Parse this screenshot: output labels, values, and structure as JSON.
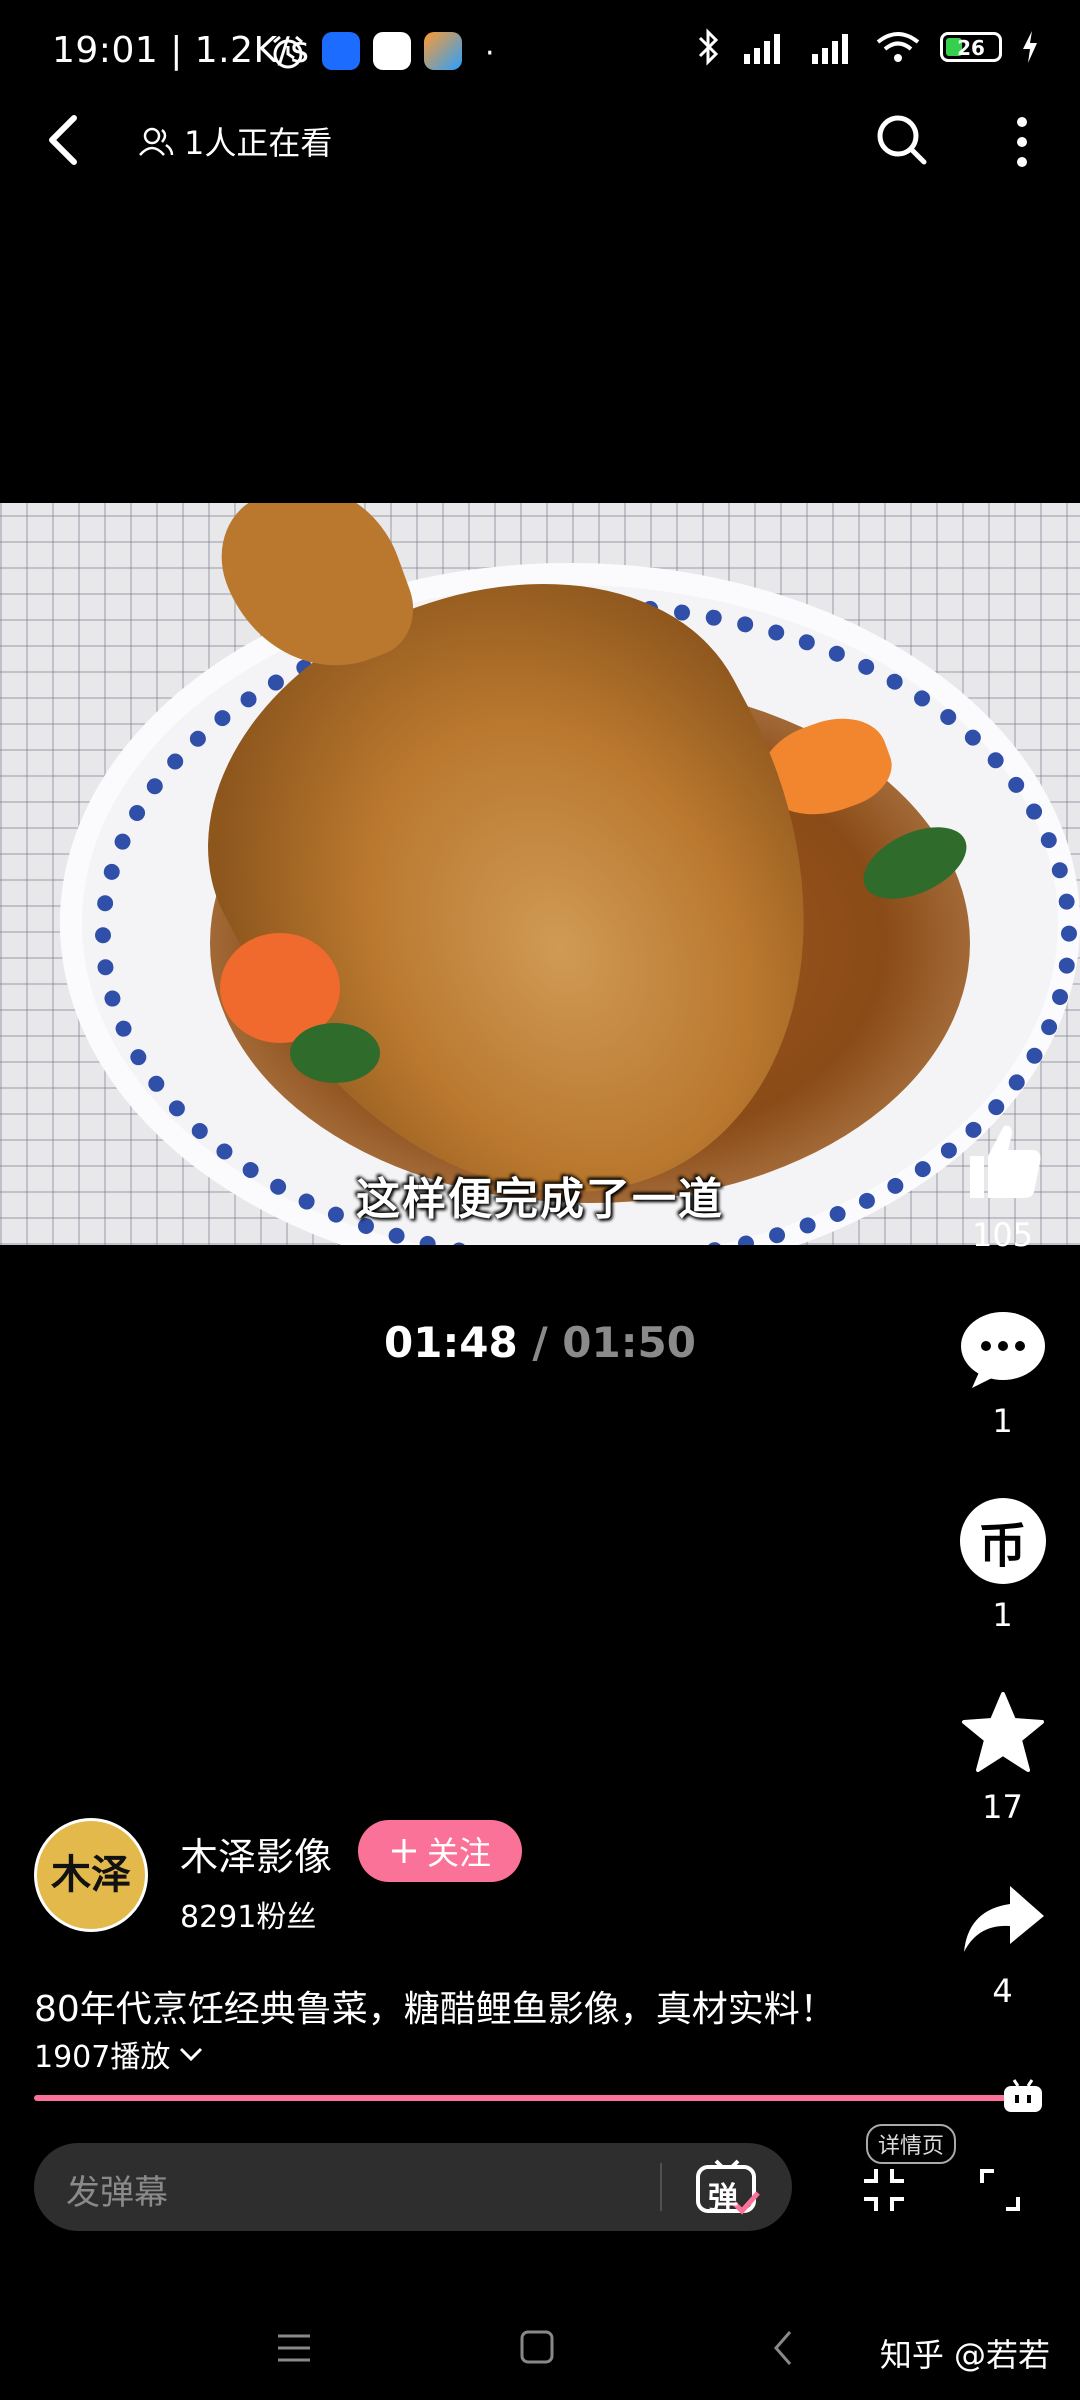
{
  "status_bar": {
    "time": "19:01 | 1.2K/s",
    "battery_level": "26",
    "icons": [
      "alarm-icon",
      "app-icon",
      "app-icon",
      "app-icon",
      "bluetooth-icon",
      "signal-icon",
      "signal-icon",
      "wifi-icon",
      "battery-icon",
      "charging-icon"
    ]
  },
  "top_bar": {
    "viewers": "1人正在看"
  },
  "video": {
    "subtitle": "这样便完成了一道"
  },
  "timecode": {
    "current": "01:48",
    "separator": "/",
    "total": "01:50"
  },
  "actions": {
    "like_count": "105",
    "comment_count": "1",
    "coin_count": "1",
    "favorite_count": "17",
    "share_count": "4",
    "coin_symbol": "币"
  },
  "author": {
    "avatar_text": "木泽",
    "name": "木泽影像",
    "follow_label": "关注",
    "fans": "8291粉丝"
  },
  "video_info": {
    "title": "80年代烹饪经典鲁菜，糖醋鲤鱼影像，真材实料！",
    "plays": "1907播放"
  },
  "playback": {
    "progress_fraction": 0.98
  },
  "bottom_bar": {
    "danmaku_placeholder": "发弹幕",
    "danmaku_button": "弹",
    "detail_label": "详情页"
  },
  "watermark": "知乎 @若若",
  "colors": {
    "accent": "#fb7299",
    "background": "#000000"
  }
}
